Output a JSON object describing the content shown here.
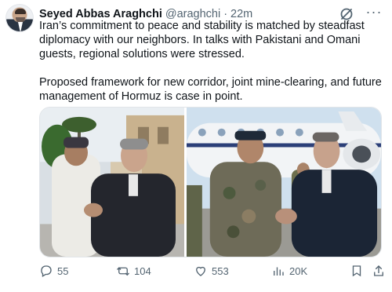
{
  "author": {
    "name": "Seyed Abbas Araghchi",
    "handle": "@araghchi",
    "separator": "·",
    "time": "22m"
  },
  "tweet": {
    "paragraph1": "Iran’s commitment to peace and stability is matched by steadfast diplomacy with our neighbors. In talks with Pakistani and Omani guests, regional solutions were stressed.",
    "paragraph2": "Proposed framework for new corridor, joint mine-clearing, and future management of Hormuz is case in point."
  },
  "actions": {
    "replies": "55",
    "reposts": "104",
    "likes": "553",
    "views": "20K"
  },
  "icons": {
    "avatar": "profile-avatar",
    "grok": "grok-icon",
    "more": "more-icon",
    "reply": "reply-icon",
    "repost": "repost-icon",
    "like": "like-icon",
    "views": "views-icon",
    "bookmark": "bookmark-icon",
    "share": "share-icon"
  },
  "colors": {
    "text": "#0f1419",
    "secondary": "#536471",
    "border": "#e1e5e9"
  }
}
